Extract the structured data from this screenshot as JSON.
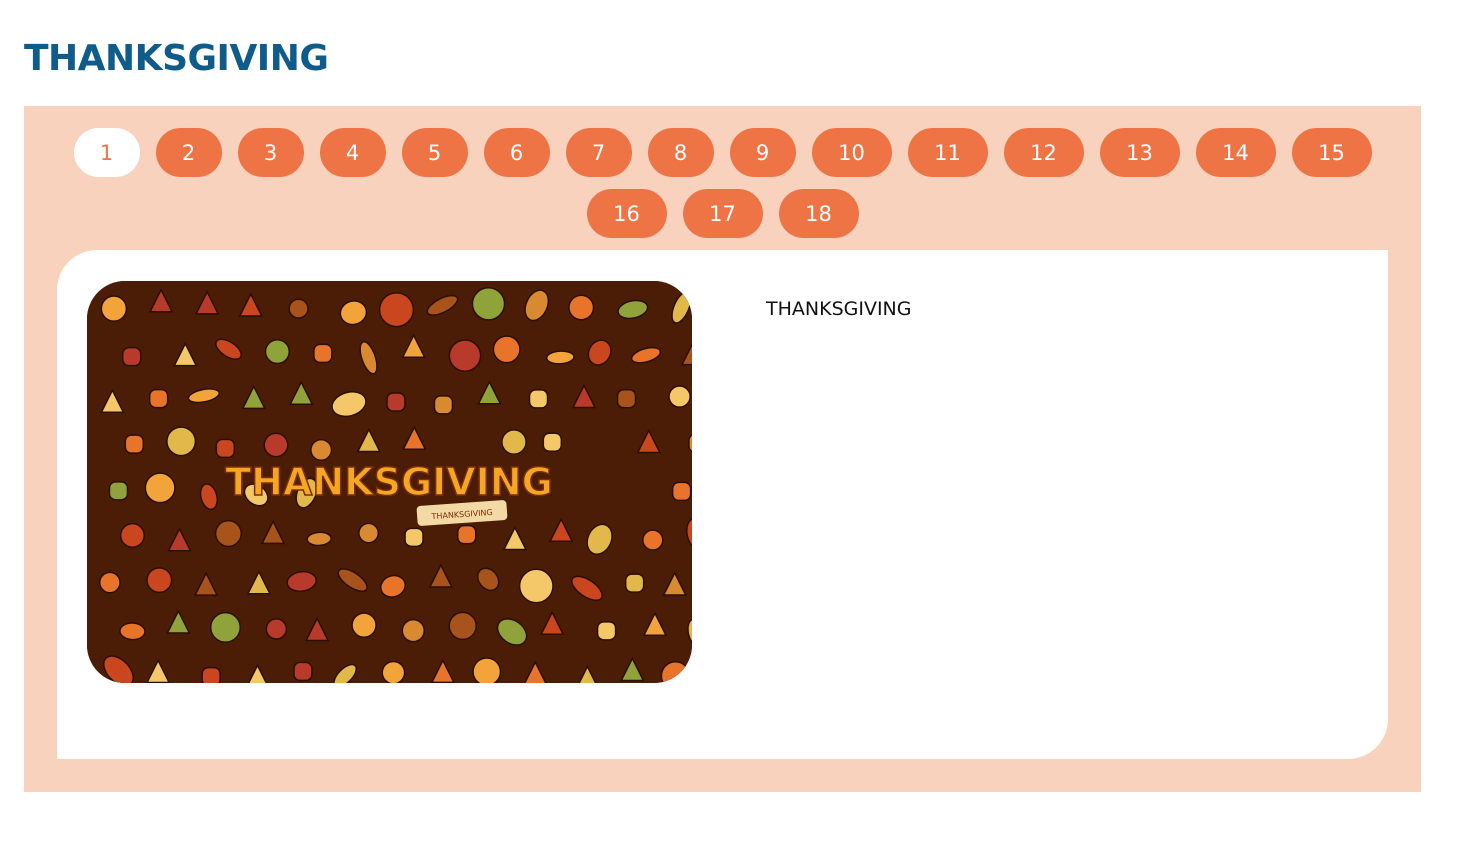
{
  "page": {
    "title": "THANKSGIVING"
  },
  "pager": {
    "items": [
      "1",
      "2",
      "3",
      "4",
      "5",
      "6",
      "7",
      "8",
      "9",
      "10",
      "11",
      "12",
      "13",
      "14",
      "15",
      "16",
      "17",
      "18"
    ],
    "active": "1"
  },
  "slide": {
    "image_alt": "Thanksgiving doodle illustration",
    "image_lettering": "THANKSGIVING",
    "image_banner": "THANKSGIVING",
    "caption": "THANKSGIVING"
  },
  "colors": {
    "title": "#0f5b8a",
    "panel": "#f8d2bd",
    "pill": "#ee7446",
    "pill_active_bg": "#ffffff",
    "image_bg": "#4b1d06"
  }
}
